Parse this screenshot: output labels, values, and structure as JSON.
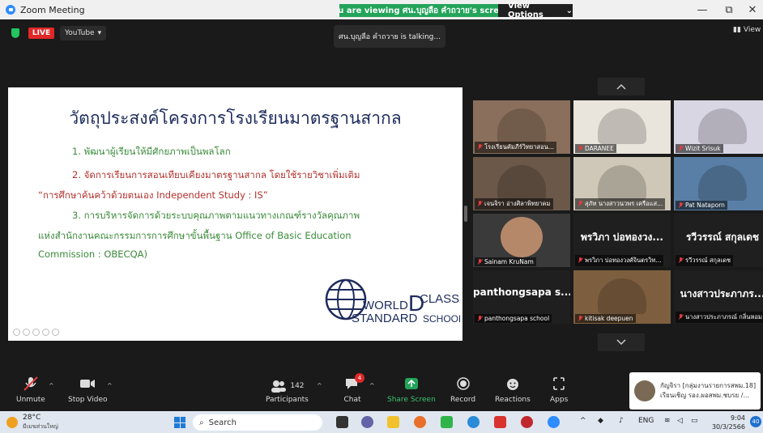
{
  "window": {
    "title": "Zoom Meeting",
    "viewing_banner": "You are viewing ศน.บุญลือ คำถวาย's screen",
    "view_options_label": "View Options",
    "controls": [
      "—",
      "⧉",
      "✕"
    ]
  },
  "meeting_header": {
    "live_badge": "LIVE",
    "youtube_label": "YouTube",
    "talking_status": "ศน.บุญลือ คำถวาย is talking...",
    "view_label": "View"
  },
  "slide": {
    "title": "วัตถุประสงค์โครงการโรงเรียนมาตรฐานสากล",
    "lines": [
      "1. พัฒนาผู้เรียนให้มีศักยภาพเป็นพลโลก",
      "2. จัดการเรียนการสอนเทียบเคียงมาตรฐานสากล โดยใช้รายวิชาเพิ่มเติม",
      "“การศึกษาค้นคว้าด้วยตนเอง Independent Study : IS”",
      "3. การบริหารจัดการด้วยระบบคุณภาพตามแนวทางเกณฑ์รางวัลคุณภาพ",
      "แห่งสำนักงานคณะกรรมการการศึกษาขั้นพื้นฐาน Office of Basic Education",
      "Commission : OBECQA)"
    ],
    "logo": {
      "word1": "WORLD",
      "word2": "CLASS",
      "word3": "STANDARD",
      "word4": "SCHOOL"
    }
  },
  "gallery": {
    "tiles": [
      {
        "name": "โรงเรียนคัมภีร์วิทยาสอน...",
        "type": "video",
        "bg": "#8a6f5c",
        "muted": true
      },
      {
        "name": "DARANEE",
        "type": "video",
        "bg": "#e9e4dc",
        "muted": true
      },
      {
        "name": "Wizit Srisuk",
        "type": "video",
        "bg": "#d9d6e4",
        "muted": true
      },
      {
        "name": "เจนจิรา อ่างศิลาพิทยาคม",
        "type": "video",
        "bg": "#6b5849",
        "muted": true
      },
      {
        "name": "สุภัท นางสาวนวพร เครือแส...",
        "type": "video",
        "bg": "#cfc8b8",
        "muted": true
      },
      {
        "name": "Pat Nataporn",
        "type": "video",
        "bg": "#5a7fa6",
        "muted": true
      },
      {
        "name": "Sainam KruNam",
        "type": "avatar",
        "bg": "#3a3a3a",
        "muted": true
      },
      {
        "name": "พรวิภา บ่อทองวงศ์จินตรวิท...",
        "type": "name",
        "big": "พรวิภา บ่อทองวง...",
        "muted": true
      },
      {
        "name": "รวีวรรณ์ สกุลเดช",
        "type": "name",
        "big": "รวีวรรณ์ สกุลเดช",
        "muted": true
      },
      {
        "name": "panthongsapa school",
        "type": "name",
        "big": "panthongsapa s...",
        "muted": true
      },
      {
        "name": "kitisak deepuen",
        "type": "video",
        "bg": "#7d5f3f",
        "muted": true
      },
      {
        "name": "นางสาวประภาภรณ์ กลิ่นหอม",
        "type": "name",
        "big": "นางสาวประภาภร...",
        "muted": true
      }
    ]
  },
  "toolbar": {
    "unmute": "Unmute",
    "stop_video": "Stop Video",
    "participants": "Participants",
    "participants_count": "142",
    "chat": "Chat",
    "chat_badge": "4",
    "share_screen": "Share Screen",
    "record": "Record",
    "reactions": "Reactions",
    "apps": "Apps"
  },
  "chat_notification": {
    "sender": "กัญจิรา [กลุ่มงานรายการสพม.18]",
    "message": "เรียนเชิญ รอง.ผอสพม.ชบรย /..."
  },
  "taskbar": {
    "temperature": "28°C",
    "weather_text": "มีเมฆส่วนใหญ่",
    "search_placeholder": "Search",
    "language": "ENG",
    "time": "9:04",
    "date": "30/3/2566",
    "notification_count": "40"
  },
  "colors": {
    "accent_green": "#23a45a",
    "live_red": "#e02828",
    "zoom_blue": "#2d8cff"
  }
}
